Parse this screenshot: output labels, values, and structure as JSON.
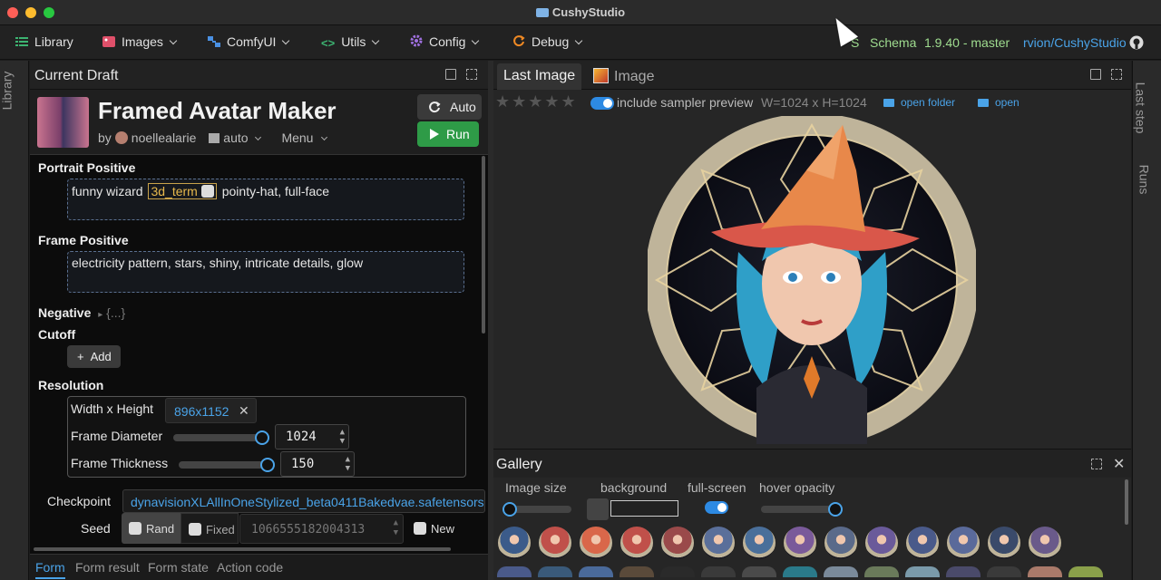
{
  "window": {
    "title": "CushyStudio"
  },
  "menu": {
    "items": [
      {
        "label": "Library"
      },
      {
        "label": "Images"
      },
      {
        "label": "ComfyUI"
      },
      {
        "label": "Utils"
      },
      {
        "label": "Config"
      },
      {
        "label": "Debug"
      }
    ],
    "partial": "S",
    "schema_label": "Schema",
    "version": "1.9.40 - master",
    "repo": "rvion/CushyStudio"
  },
  "rails": {
    "left_label": "Library",
    "right_labels": [
      "Last step",
      "Runs"
    ]
  },
  "draft": {
    "panel_title": "Current Draft",
    "app_title": "Framed Avatar Maker",
    "by": "by",
    "author": "noellealarie",
    "mode": "auto",
    "menu_label": "Menu",
    "auto_label": "Auto",
    "run_label": "Run",
    "portrait_label": "Portrait Positive",
    "portrait_text_before": "funny wizard",
    "portrait_tag": "3d_term",
    "portrait_text_after": "pointy-hat, full-face",
    "frame_label": "Frame Positive",
    "frame_text": "electricity pattern, stars, shiny, intricate details, glow",
    "negative_label": "Negative",
    "negative_hint": "{...}",
    "cutoff_label": "Cutoff",
    "add_label": "Add",
    "resolution_label": "Resolution",
    "wh_label": "Width x Height",
    "wh_value": "896x1152",
    "diameter_label": "Frame Diameter",
    "diameter_value": "1024",
    "thickness_label": "Frame Thickness",
    "thickness_value": "150",
    "checkpoint_label": "Checkpoint",
    "checkpoint_value": "dynavisionXLAllInOneStylized_beta0411Bakedvae.safetensors",
    "seed_label": "Seed",
    "seed_rand": "Rand",
    "seed_fixed": "Fixed",
    "seed_value": "1066555182004313",
    "seed_new": "New",
    "tabs": [
      {
        "label": "Form"
      },
      {
        "label": "Form result"
      },
      {
        "label": "Form state"
      },
      {
        "label": "Action code"
      }
    ]
  },
  "image_panel": {
    "tab_last": "Last Image",
    "tab_image": "Image",
    "rating": 0,
    "include_label": "include sampler preview",
    "dims": "W=1024 x H=1024",
    "open_folder": "open folder",
    "open": "open"
  },
  "gallery": {
    "title": "Gallery",
    "image_size_label": "Image size",
    "background_label": "background",
    "fullscreen_label": "full-screen",
    "hover_label": "hover opacity"
  },
  "colors": {
    "accent": "#2d8ae3",
    "run_green": "#2e9b47",
    "link_blue": "#4aa3e8",
    "tag_gold": "#e8b94c",
    "schema_green": "#9fdc8f"
  }
}
